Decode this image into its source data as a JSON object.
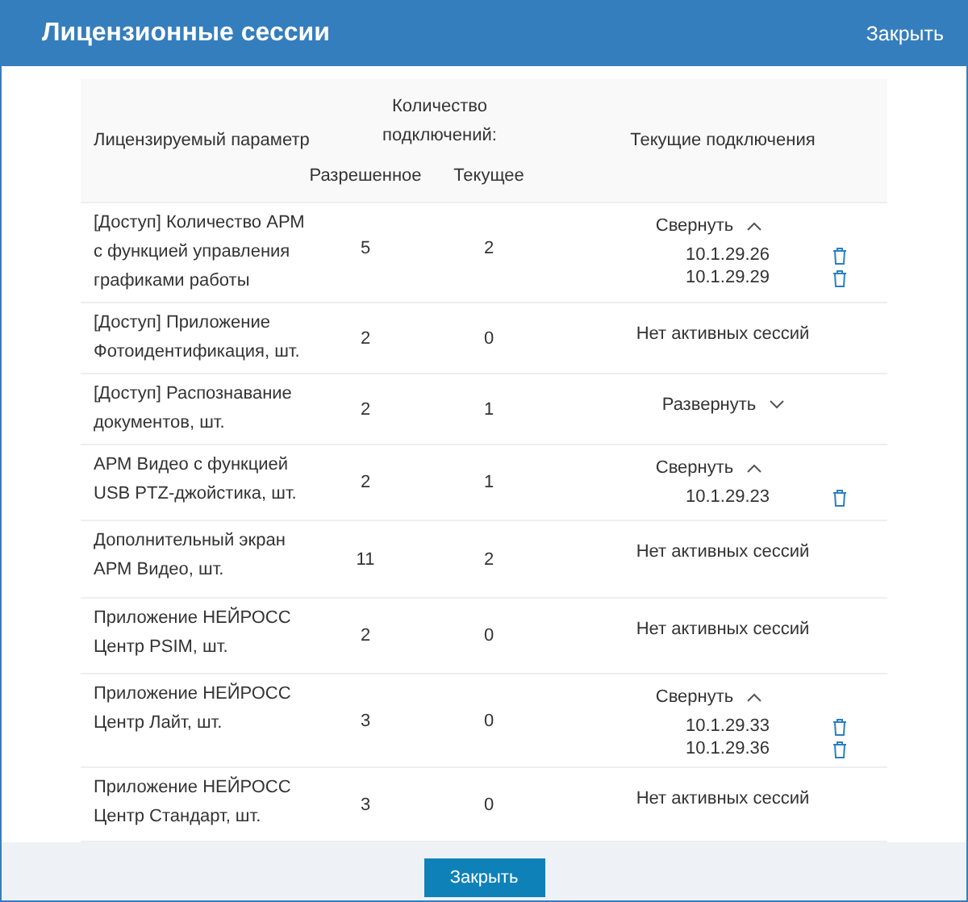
{
  "window": {
    "title": "Лицензионные сессии",
    "close_link": "Закрыть"
  },
  "table": {
    "columns": {
      "parameter": "Лицензируемый параметр",
      "count_group": "Количество подключений:",
      "allowed": "Разрешенное",
      "current": "Текущее",
      "sessions": "Текущие подключения"
    },
    "rows": [
      {
        "parameter": "[Доступ] Количество АРМ с функцией управления графиками работы",
        "allowed": "5",
        "current": "2",
        "sessions": {
          "kind": "expanded",
          "toggle": "Свернуть",
          "ips": [
            "10.1.29.26",
            "10.1.29.29"
          ]
        }
      },
      {
        "parameter": "[Доступ] Приложение Фотоидентификация, шт.",
        "allowed": "2",
        "current": "0",
        "sessions": {
          "kind": "none",
          "text": "Нет активных сессий"
        }
      },
      {
        "parameter": "[Доступ] Распознавание документов, шт.",
        "allowed": "2",
        "current": "1",
        "sessions": {
          "kind": "collapsed",
          "toggle": "Развернуть"
        }
      },
      {
        "parameter": "АРМ Видео с функцией USB PTZ-джойстика, шт.",
        "allowed": "2",
        "current": "1",
        "sessions": {
          "kind": "expanded",
          "toggle": "Свернуть",
          "ips": [
            "10.1.29.23"
          ]
        }
      },
      {
        "parameter": "Дополнительный экран АРМ Видео, шт.",
        "allowed": "11",
        "current": "2",
        "sessions": {
          "kind": "none",
          "text": "Нет активных сессий"
        }
      },
      {
        "parameter": "Приложение НЕЙРОСС Центр PSIM, шт.",
        "allowed": "2",
        "current": "0",
        "sessions": {
          "kind": "none",
          "text": "Нет активных сессий"
        }
      },
      {
        "parameter": "Приложение НЕЙРОСС Центр Лайт, шт.",
        "allowed": "3",
        "current": "0",
        "sessions": {
          "kind": "expanded",
          "toggle": "Свернуть",
          "ips": [
            "10.1.29.33",
            "10.1.29.36"
          ]
        }
      },
      {
        "parameter": "Приложение НЕЙРОСС Центр Стандарт, шт.",
        "allowed": "3",
        "current": "0",
        "sessions": {
          "kind": "none",
          "text": "Нет активных сессий"
        }
      }
    ]
  },
  "footer": {
    "button": "Закрыть"
  }
}
